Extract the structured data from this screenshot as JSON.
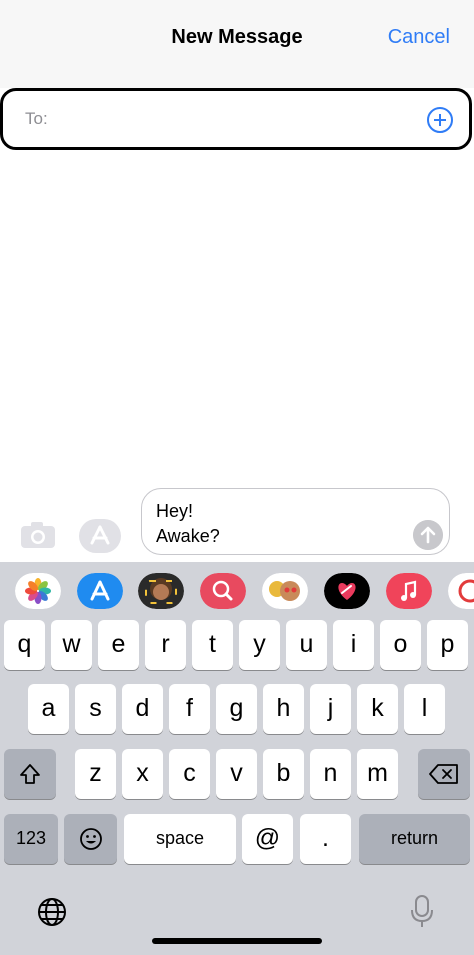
{
  "header": {
    "title": "New Message",
    "cancel_label": "Cancel"
  },
  "recipient": {
    "label": "To:"
  },
  "composer": {
    "message_lines": [
      "Hey!",
      "Awake?"
    ]
  },
  "apps_row": [
    "Photos",
    "App Store",
    "Memoji",
    "Images",
    "Memoji Stickers",
    "Digital Touch",
    "Music",
    "Partial app"
  ],
  "keyboard": {
    "row1": [
      "q",
      "w",
      "e",
      "r",
      "t",
      "y",
      "u",
      "i",
      "o",
      "p"
    ],
    "row2": [
      "a",
      "s",
      "d",
      "f",
      "g",
      "h",
      "j",
      "k",
      "l"
    ],
    "row3": [
      "z",
      "x",
      "c",
      "v",
      "b",
      "n",
      "m"
    ],
    "numbers_label": "123",
    "space_label": "space",
    "at_label": "@",
    "period_label": ".",
    "return_label": "return"
  },
  "colors": {
    "accent": "#2f7cf6",
    "keyboard_bg": "#d1d3d9",
    "header_bg": "#f7f7f7"
  }
}
